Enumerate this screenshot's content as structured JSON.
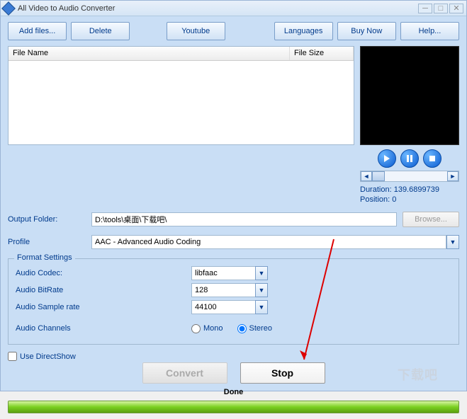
{
  "window": {
    "title": "All Video to Audio Converter"
  },
  "toolbar": {
    "add_files": "Add files...",
    "delete": "Delete",
    "youtube": "Youtube",
    "languages": "Languages",
    "buy_now": "Buy Now",
    "help": "Help..."
  },
  "filelist": {
    "columns": [
      "File Name",
      "File Size"
    ]
  },
  "preview": {
    "duration_label": "Duration:",
    "duration_value": "139.6899739",
    "position_label": "Position:",
    "position_value": "0"
  },
  "form": {
    "output_folder_label": "Output Folder:",
    "output_folder_value": "D:\\tools\\桌面\\下载吧\\",
    "browse": "Browse...",
    "profile_label": "Profile",
    "profile_value": "AAC - Advanced Audio Coding",
    "use_directshow": "Use DirectShow"
  },
  "format": {
    "legend": "Format Settings",
    "codec_label": "Audio Codec:",
    "codec_value": "libfaac",
    "bitrate_label": "Audio BitRate",
    "bitrate_value": "128",
    "samplerate_label": "Audio Sample rate",
    "samplerate_value": "44100",
    "channels_label": "Audio Channels",
    "mono": "Mono",
    "stereo": "Stereo"
  },
  "actions": {
    "convert": "Convert",
    "stop": "Stop"
  },
  "status": {
    "text": "Done"
  },
  "watermark": "下载吧"
}
